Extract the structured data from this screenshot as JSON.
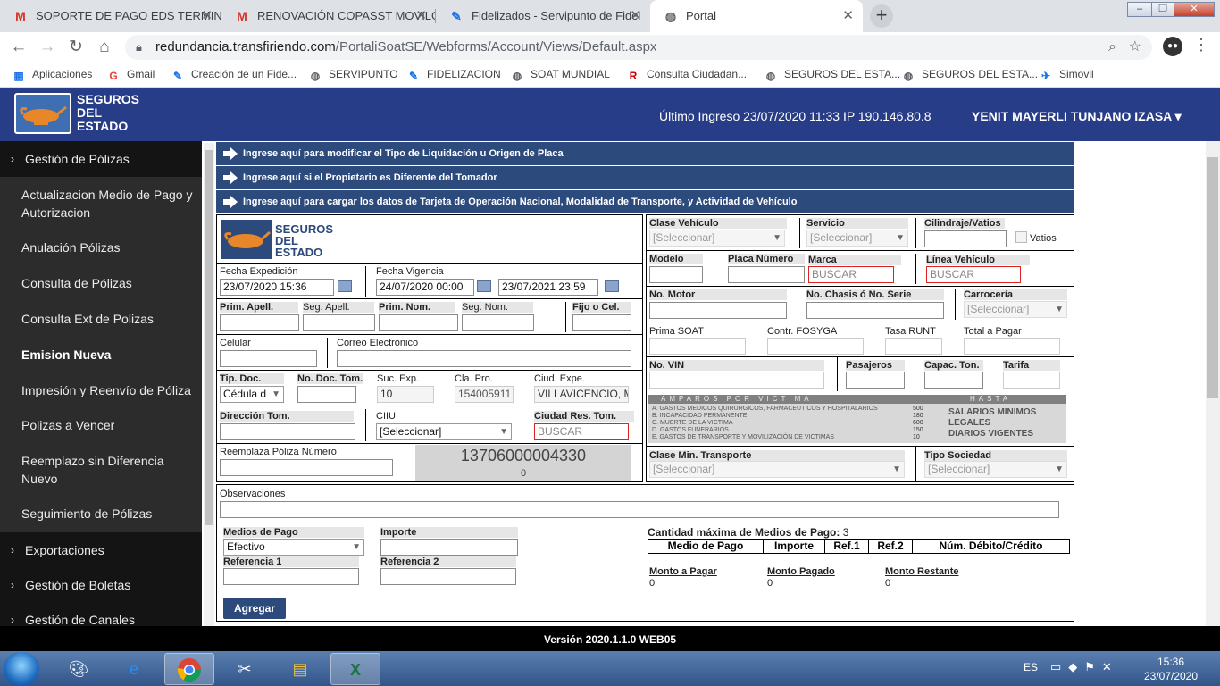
{
  "browser": {
    "tabs": [
      {
        "title": "SOPORTE DE PAGO EDS TERMIN",
        "icon": "M",
        "icon_color": "#d93025"
      },
      {
        "title": "RENOVACIÓN COPASST MOVILG",
        "icon": "M",
        "icon_color": "#d93025"
      },
      {
        "title": "Fidelizados - Servipunto de Fidel",
        "icon": "✎",
        "icon_color": "#1a73e8"
      },
      {
        "title": "Portal",
        "icon": "◍",
        "icon_color": "#5f6368"
      }
    ],
    "new_tab": "+",
    "window_controls": [
      "–",
      "❐",
      "✕"
    ],
    "url_host": "redundancia.transfiriendo.com",
    "url_path": "/PortaliSoatSE/Webforms/Account/Views/Default.aspx",
    "bookmarks": [
      {
        "label": "Aplicaciones",
        "icon": "⁞⁞⁞",
        "icon_color": "#1a73e8"
      },
      {
        "label": "Gmail",
        "icon": "G",
        "icon_color": "#ea4335"
      },
      {
        "label": "Creación de un Fide...",
        "icon": "✎",
        "icon_color": "#1a73e8"
      },
      {
        "label": "SERVIPUNTO",
        "icon": "◍",
        "icon_color": "#5f6368"
      },
      {
        "label": "FIDELIZACION",
        "icon": "✎",
        "icon_color": "#1a73e8"
      },
      {
        "label": "SOAT MUNDIAL",
        "icon": "◍",
        "icon_color": "#5f6368"
      },
      {
        "label": "Consulta Ciudadan...",
        "icon": "R",
        "icon_color": "#c00"
      },
      {
        "label": "SEGUROS DEL ESTA...",
        "icon": "◍",
        "icon_color": "#5f6368"
      },
      {
        "label": "SEGUROS DEL ESTA...",
        "icon": "◍",
        "icon_color": "#5f6368"
      },
      {
        "label": "Simovil",
        "icon": "✈",
        "icon_color": "#1a73e8"
      }
    ]
  },
  "header": {
    "logo_line1": "SEGUROS",
    "logo_line2": "DEL",
    "logo_line3": "ESTADO",
    "last_login": "Último Ingreso 23/07/2020 11:33 IP 190.146.80.8",
    "username": "YENIT MAYERLI TUNJANO IZASA ▾"
  },
  "sidebar": {
    "items": [
      {
        "label": "Gestión de Pólizas",
        "type": "top"
      },
      {
        "label": "Actualizacion Medio de Pago y Autorizacion",
        "type": "sub"
      },
      {
        "label": "Anulación Pólizas",
        "type": "sub"
      },
      {
        "label": "Consulta de Pólizas",
        "type": "sub"
      },
      {
        "label": "Consulta Ext de Polizas",
        "type": "sub"
      },
      {
        "label": "Emision Nueva",
        "type": "sub-active"
      },
      {
        "label": "Impresión y Reenvío de Póliza",
        "type": "sub"
      },
      {
        "label": "Polizas a Vencer",
        "type": "sub"
      },
      {
        "label": "Reemplazo sin Diferencia Nuevo",
        "type": "sub"
      },
      {
        "label": "Seguimiento de Pólizas",
        "type": "sub"
      },
      {
        "label": "Exportaciones",
        "type": "top"
      },
      {
        "label": "Gestión de Boletas",
        "type": "top"
      },
      {
        "label": "Gestión de Canales",
        "type": "top"
      }
    ]
  },
  "bars": [
    "Ingrese aquí para modificar el Tipo de Liquidación u Origen de Placa",
    "Ingrese aquí si el Propietario es Diferente del Tomador",
    "Ingrese aquí para cargar los datos de Tarjeta de Operación Nacional, Modalidad de Transporte, y Actividad de Vehículo"
  ],
  "left_form": {
    "fecha_expedicion_label": "Fecha Expedición",
    "fecha_expedicion": "23/07/2020 15:36",
    "fecha_vigencia_label": "Fecha Vigencia",
    "vigencia_desde": "24/07/2020 00:00",
    "vigencia_hasta": "23/07/2021 23:59",
    "prim_apell": "Prim. Apell.",
    "seg_apell": "Seg. Apell.",
    "prim_nom": "Prim. Nom.",
    "seg_nom": "Seg. Nom.",
    "fijo_cel": "Fijo o Cel.",
    "celular": "Celular",
    "correo": "Correo Electrónico",
    "tip_doc_label": "Tip. Doc.",
    "tip_doc_value": "Cédula d",
    "no_doc_tom": "No. Doc. Tom.",
    "suc_exp_label": "Suc. Exp.",
    "suc_exp_value": "10",
    "cla_pro_label": "Cla. Pro.",
    "cla_pro_value": "154005911",
    "ciud_expe_label": "Ciud. Expe.",
    "ciud_expe_value": "VILLAVICENCIO, M",
    "direccion_tom": "Dirección Tom.",
    "ciiu_label": "CIIU",
    "ciiu_value": "[Seleccionar]",
    "ciudad_res_tom": "Ciudad Res. Tom.",
    "ciudad_res_value": "BUSCAR",
    "reemplaza_label": "Reemplaza Póliza Número",
    "poliza_numero": "13706000004330",
    "poliza_sub": "0"
  },
  "right_form": {
    "clase_vehiculo_label": "Clase Vehículo",
    "clase_vehiculo_value": "[Seleccionar]",
    "servicio_label": "Servicio",
    "servicio_value": "[Seleccionar]",
    "cilindraje_label": "Cilindraje/Vatios",
    "vatios_label": "Vatios",
    "modelo_label": "Modelo",
    "placa_label": "Placa Número",
    "marca_label": "Marca",
    "marca_value": "BUSCAR",
    "linea_label": "Línea Vehículo",
    "linea_value": "BUSCAR",
    "no_motor_label": "No. Motor",
    "no_chasis_label": "No. Chasis ó No. Serie",
    "carroceria_label": "Carrocería",
    "carroceria_value": "[Seleccionar]",
    "prima_soat_label": "Prima SOAT",
    "contr_fosyga_label": "Contr. FOSYGA",
    "tasa_runt_label": "Tasa RUNT",
    "total_pagar_label": "Total a Pagar",
    "no_vin_label": "No. VIN",
    "pasajeros_label": "Pasajeros",
    "capac_ton_label": "Capac. Ton.",
    "tarifa_label": "Tarifa",
    "amparos_title": "AMPAROS POR VICTIMA",
    "amparos_hasta": "HASTA",
    "amparos_rows": [
      "A. GASTOS MEDICOS QUIRURGICOS, FARMACEUTICOS Y HOSPITALARIOS",
      "B. INCAPACIDAD PERMANENTE",
      "C. MUERTE DE LA VICTIMA",
      "D. GASTOS FUNERARIOS",
      "E. GASTOS DE TRANSPORTE Y MOVILIZACIÓN DE VICTIMAS"
    ],
    "amparos_values": [
      "500",
      "180",
      "600",
      "150",
      "10"
    ],
    "amparos_note": [
      "SALARIOS MINIMOS",
      "LEGALES",
      "DIARIOS VIGENTES"
    ],
    "clase_min_label": "Clase Min. Transporte",
    "clase_min_value": "[Seleccionar]",
    "tipo_sociedad_label": "Tipo Sociedad",
    "tipo_sociedad_value": "[Seleccionar]"
  },
  "observaciones_label": "Observaciones",
  "payment": {
    "medios_label": "Medios de Pago",
    "medios_value": "Efectivo",
    "importe_label": "Importe",
    "referencia1_label": "Referencia 1",
    "referencia2_label": "Referencia 2",
    "agregar_label": "Agregar",
    "cantidad_label": "Cantidad máxima de Medios de Pago:",
    "cantidad_value": "3",
    "table_headers": [
      "Medio de Pago",
      "Importe",
      "Ref.1",
      "Ref.2",
      "Núm. Débito/Crédito"
    ],
    "monto_pagar_label": "Monto a Pagar",
    "monto_pagar_value": "0",
    "monto_pagado_label": "Monto Pagado",
    "monto_pagado_value": "0",
    "monto_restante_label": "Monto Restante",
    "monto_restante_value": "0"
  },
  "footer": {
    "version": "Versión 2020.1.1.0 WEB05"
  },
  "taskbar": {
    "lang": "ES",
    "time": "15:36",
    "date": "23/07/2020"
  }
}
